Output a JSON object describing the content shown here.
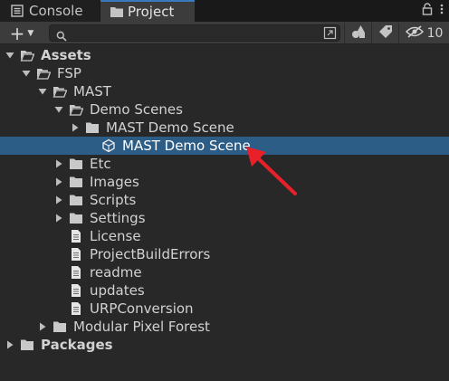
{
  "tabs": {
    "console_label": "Console",
    "project_label": "Project"
  },
  "toolbar": {
    "create_icon": "plus-icon",
    "search_value": "",
    "search_placeholder": "",
    "hidden_count": "10"
  },
  "tree": [
    {
      "label": "Assets",
      "depth": 0,
      "expand": "open",
      "icon": "folder-open",
      "bold": true,
      "selected": false
    },
    {
      "label": "FSP",
      "depth": 1,
      "expand": "open",
      "icon": "folder-open",
      "bold": false,
      "selected": false
    },
    {
      "label": "MAST",
      "depth": 2,
      "expand": "open",
      "icon": "folder-open",
      "bold": false,
      "selected": false
    },
    {
      "label": "Demo Scenes",
      "depth": 3,
      "expand": "open",
      "icon": "folder-open",
      "bold": false,
      "selected": false
    },
    {
      "label": "MAST Demo Scene",
      "depth": 4,
      "expand": "closed",
      "icon": "folder",
      "bold": false,
      "selected": false
    },
    {
      "label": "MAST Demo Scene",
      "depth": 5,
      "expand": "none",
      "icon": "scene",
      "bold": false,
      "selected": true
    },
    {
      "label": "Etc",
      "depth": 3,
      "expand": "closed",
      "icon": "folder",
      "bold": false,
      "selected": false
    },
    {
      "label": "Images",
      "depth": 3,
      "expand": "closed",
      "icon": "folder",
      "bold": false,
      "selected": false
    },
    {
      "label": "Scripts",
      "depth": 3,
      "expand": "closed",
      "icon": "folder",
      "bold": false,
      "selected": false
    },
    {
      "label": "Settings",
      "depth": 3,
      "expand": "closed",
      "icon": "folder",
      "bold": false,
      "selected": false
    },
    {
      "label": "License",
      "depth": 3,
      "expand": "none",
      "icon": "file",
      "bold": false,
      "selected": false
    },
    {
      "label": "ProjectBuildErrors",
      "depth": 3,
      "expand": "none",
      "icon": "file",
      "bold": false,
      "selected": false
    },
    {
      "label": "readme",
      "depth": 3,
      "expand": "none",
      "icon": "file",
      "bold": false,
      "selected": false
    },
    {
      "label": "updates",
      "depth": 3,
      "expand": "none",
      "icon": "file",
      "bold": false,
      "selected": false
    },
    {
      "label": "URPConversion",
      "depth": 3,
      "expand": "none",
      "icon": "file",
      "bold": false,
      "selected": false
    },
    {
      "label": "Modular Pixel Forest",
      "depth": 2,
      "expand": "closed",
      "icon": "folder",
      "bold": false,
      "selected": false
    },
    {
      "label": "Packages",
      "depth": 0,
      "expand": "closed",
      "icon": "folder",
      "bold": true,
      "selected": false
    }
  ],
  "colors": {
    "selection": "#2c5d87",
    "pointer_arrow": "#e8202a",
    "background": "#282828"
  }
}
